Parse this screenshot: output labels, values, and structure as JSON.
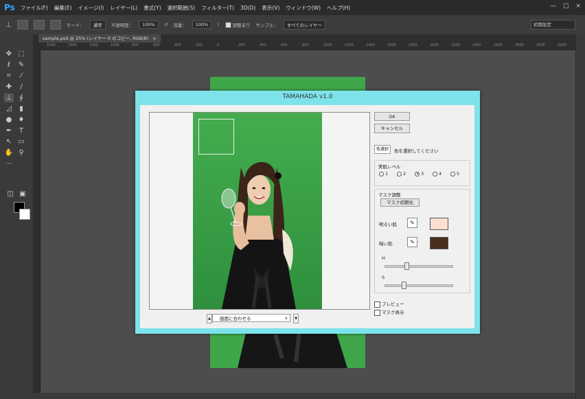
{
  "app": {
    "logo": "Ps"
  },
  "menu": [
    "ファイル(F)",
    "編集(E)",
    "イメージ(I)",
    "レイヤー(L)",
    "書式(Y)",
    "選択範囲(S)",
    "フィルター(T)",
    "3D(D)",
    "表示(V)",
    "ウィンドウ(W)",
    "ヘルプ(H)"
  ],
  "window_controls": {
    "minimize": "—",
    "maximize": "□",
    "close": "×"
  },
  "options": {
    "mode_label": "モード：",
    "mode_value": "通常",
    "opacity_label": "不透明度：",
    "opacity_value": "100%",
    "flow_label": "流量：",
    "flow_value": "100%",
    "aligned_label": "調整あり",
    "sample_label": "サンプル：",
    "sample_value": "すべてのレイヤー",
    "workspace": "初期設定"
  },
  "document": {
    "tab_title": "sample.psd @ 25% (レイヤー 0 のコピー, RGB/8)",
    "tab_close": "×"
  },
  "ruler": [
    "1000",
    "1900",
    "1200",
    "1000",
    "800",
    "600",
    "400",
    "200",
    "0",
    "200",
    "400",
    "600",
    "800",
    "1000",
    "1200",
    "1400",
    "1600",
    "1800",
    "2000",
    "2200",
    "2400",
    "2600",
    "2800",
    "3000",
    "3200"
  ],
  "dialog": {
    "title": "TAMAHADA v1.0",
    "ok": "OK",
    "cancel": "キャンセル",
    "select_color": "色選択",
    "select_color_msg": "色を選択してください",
    "skin_level_label": "美肌レベル",
    "skin_levels": [
      "1",
      "2",
      "3",
      "4",
      "5"
    ],
    "skin_level_selected": "3",
    "mask_group_label": "マスク調整",
    "mask_init": "マスク初期化",
    "light_skin": "明るい肌",
    "dark_skin": "暗い肌",
    "light_skin_color": "#fde0d0",
    "dark_skin_color": "#4a2e1f",
    "h_label": "H",
    "s_label": "S",
    "h_value": 0.3,
    "s_value": 0.25,
    "preview_label": "プレビュー",
    "mask_display_label": "マスク表示",
    "fit_option": "画面に合わせる"
  },
  "colors": {
    "accent": "#31a8ff",
    "dialog_frame": "#7de3eb",
    "green_backdrop": "#3fa64a"
  },
  "icons": [
    "move-icon",
    "marquee-icon",
    "lasso-icon",
    "quick-select-icon",
    "crop-icon",
    "eyedropper-icon",
    "healing-icon",
    "brush-icon",
    "stamp-icon",
    "history-brush-icon",
    "eraser-icon",
    "gradient-icon",
    "blur-icon",
    "dodge-icon",
    "pen-icon",
    "type-icon",
    "path-select-icon",
    "shape-icon",
    "hand-icon",
    "zoom-icon"
  ]
}
